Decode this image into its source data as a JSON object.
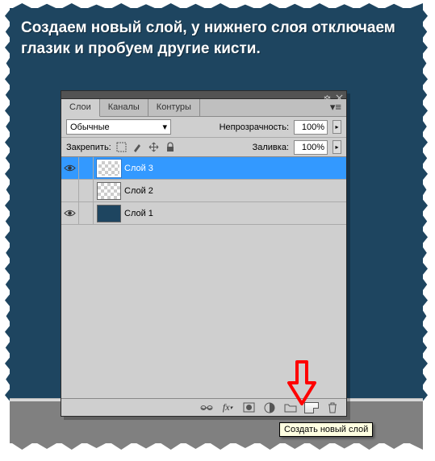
{
  "caption": "Создаем новый слой, у нижнего слоя отключаем глазик и пробуем другие кисти.",
  "tabs": {
    "layers": "Слои",
    "channels": "Каналы",
    "paths": "Контуры"
  },
  "blend": {
    "mode": "Обычные",
    "opacity_label": "Непрозрачность:",
    "opacity_value": "100%"
  },
  "lock": {
    "label": "Закрепить:",
    "fill_label": "Заливка:",
    "fill_value": "100%"
  },
  "layers": [
    {
      "name": "Слой 3",
      "visible": true,
      "thumb": "checker",
      "selected": true
    },
    {
      "name": "Слой 2",
      "visible": false,
      "thumb": "checker",
      "selected": false
    },
    {
      "name": "Слой 1",
      "visible": true,
      "thumb": "dark",
      "selected": false
    }
  ],
  "tooltip": "Создать новый слой",
  "icons": {
    "eye": "eye-icon",
    "link": "link-icon",
    "fx": "fx-icon",
    "mask": "mask-icon",
    "adjust": "adjustment-icon",
    "group": "group-icon",
    "new": "new-layer-icon",
    "trash": "trash-icon",
    "collapse": "collapse-icon",
    "menu": "menu-icon",
    "lock_trans": "lock-transparency-icon",
    "lock_paint": "lock-paint-icon",
    "lock_move": "lock-move-icon",
    "lock_all": "lock-all-icon"
  }
}
